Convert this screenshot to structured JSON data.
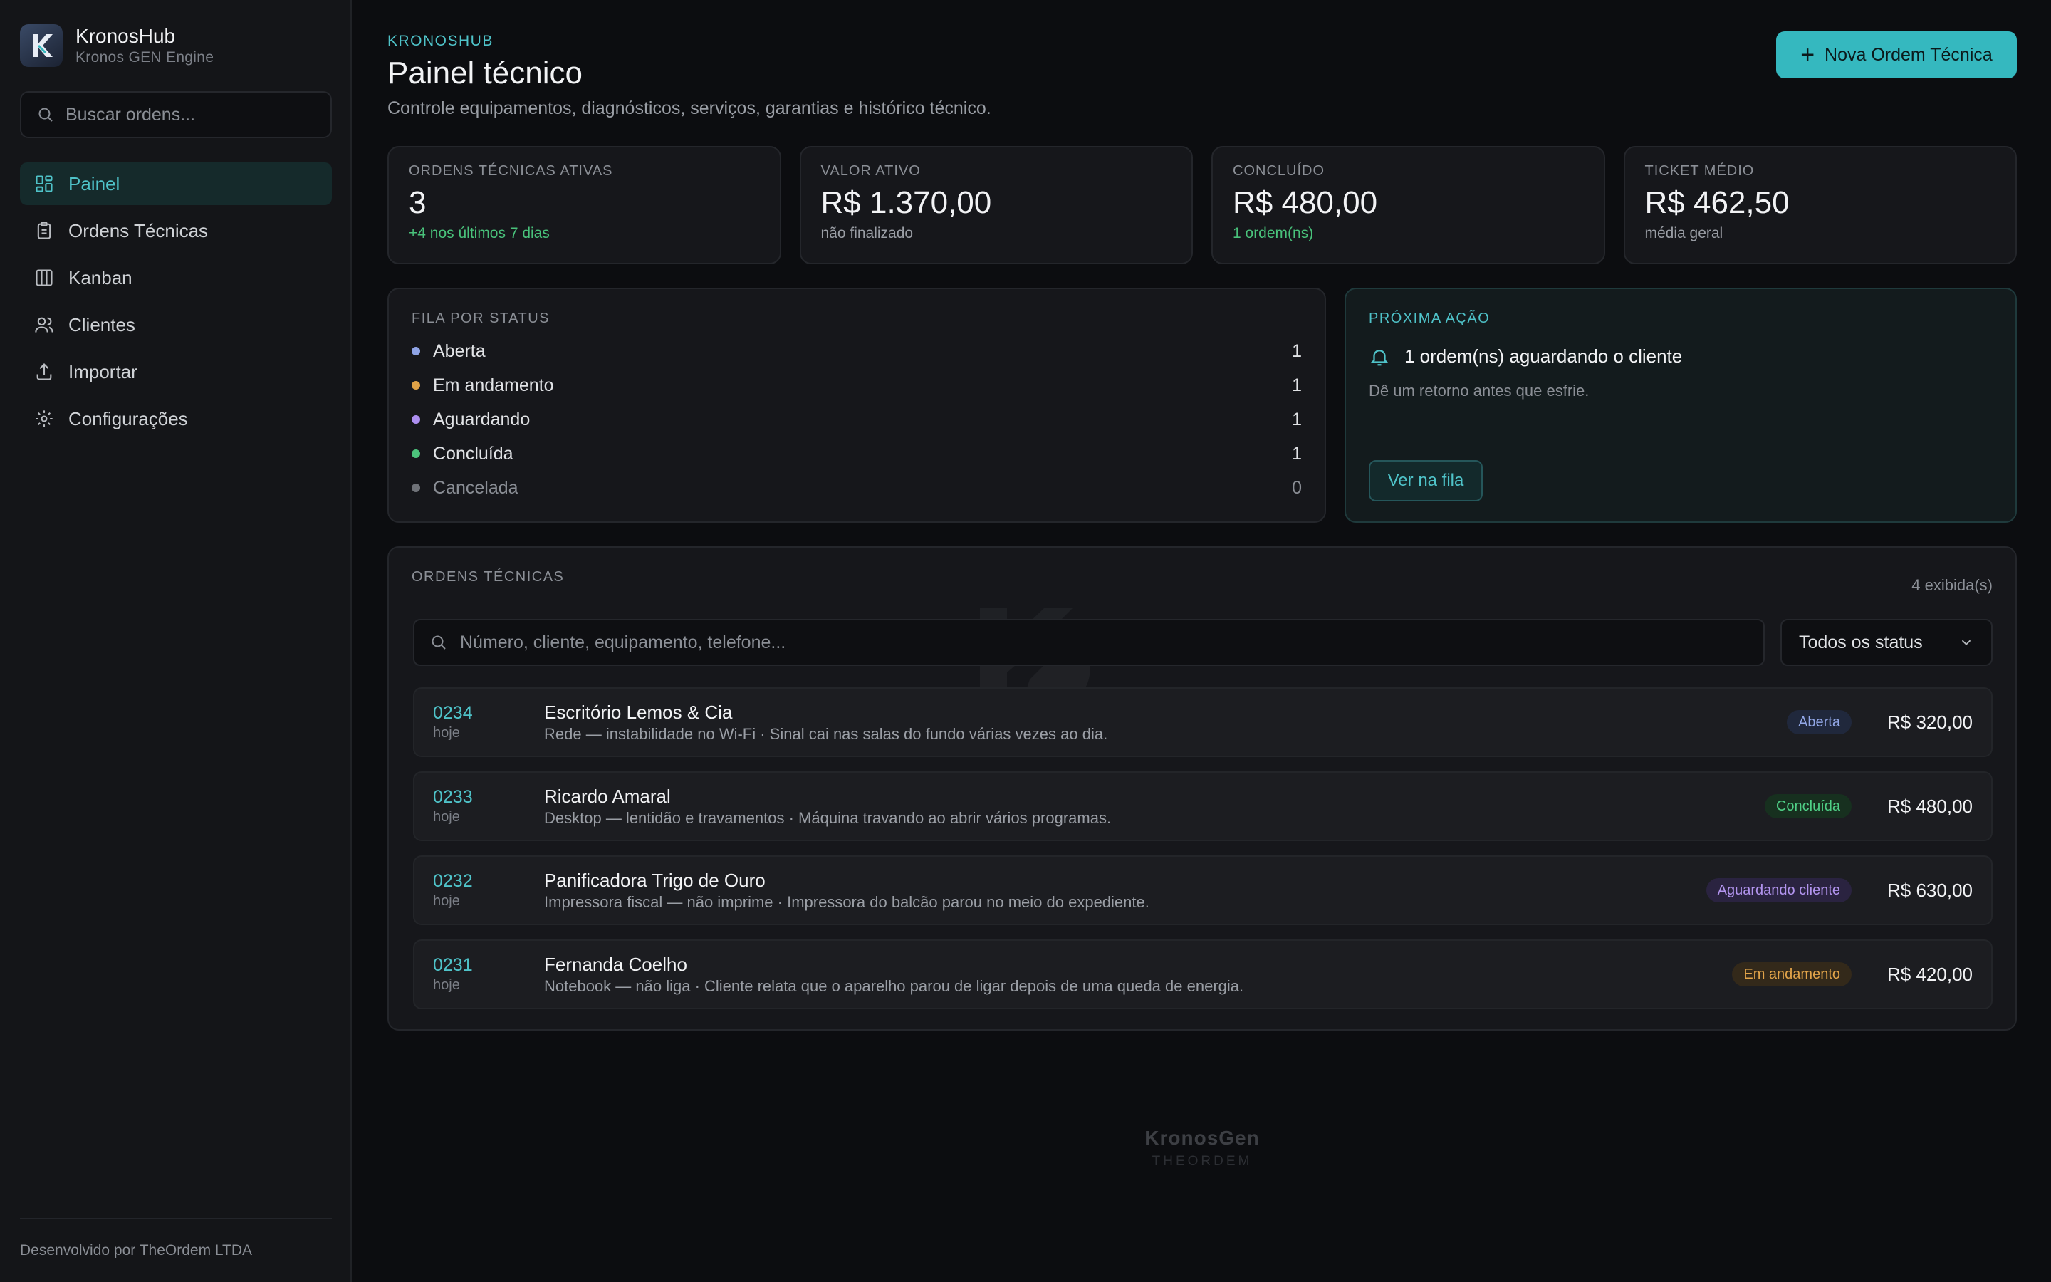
{
  "brand": {
    "name": "KronosHub",
    "subtitle": "Kronos GEN Engine",
    "logo_icon": "kronos-k-logo"
  },
  "sidebar": {
    "search_placeholder": "Buscar ordens...",
    "items": [
      {
        "label": "Painel",
        "icon": "dashboard-icon",
        "active": true
      },
      {
        "label": "Ordens Técnicas",
        "icon": "clipboard-icon"
      },
      {
        "label": "Kanban",
        "icon": "columns-icon"
      },
      {
        "label": "Clientes",
        "icon": "users-icon"
      },
      {
        "label": "Importar",
        "icon": "upload-icon"
      },
      {
        "label": "Configurações",
        "icon": "gear-icon"
      }
    ],
    "footer": "Desenvolvido por TheOrdem LTDA"
  },
  "header": {
    "eyebrow": "KRONOSHUB",
    "title": "Painel técnico",
    "description": "Controle equipamentos, diagnósticos, serviços, garantias e histórico técnico.",
    "new_button": "Nova Ordem Técnica"
  },
  "stats": [
    {
      "label": "ORDENS TÉCNICAS ATIVAS",
      "value": "3",
      "note": "+4 nos últimos 7 dias",
      "note_color": "#49c27b"
    },
    {
      "label": "VALOR ATIVO",
      "value": "R$ 1.370,00",
      "note": "não finalizado"
    },
    {
      "label": "CONCLUÍDO",
      "value": "R$ 480,00",
      "note": "1 ordem(ns)",
      "note_color": "#49c27b"
    },
    {
      "label": "TICKET MÉDIO",
      "value": "R$ 462,50",
      "note": "média geral"
    }
  ],
  "queue": {
    "label": "FILA POR STATUS",
    "rows": [
      {
        "name": "Aberta",
        "count": "1",
        "color": "#8fa4e6"
      },
      {
        "name": "Em andamento",
        "count": "1",
        "color": "#e0a247"
      },
      {
        "name": "Aguardando",
        "count": "1",
        "color": "#ad8ff0"
      },
      {
        "name": "Concluída",
        "count": "1",
        "color": "#4cc47c"
      },
      {
        "name": "Cancelada",
        "count": "0",
        "color": "#6f7278"
      }
    ]
  },
  "next_action": {
    "label": "PRÓXIMA AÇÃO",
    "title": "1 ordem(ns) aguardando o cliente",
    "description": "Dê um retorno antes que esfrie.",
    "button": "Ver na fila",
    "icon": "bell-icon"
  },
  "orders": {
    "label": "ORDENS TÉCNICAS",
    "count_text": "4 exibida(s)",
    "search_placeholder": "Número, cliente, equipamento, telefone...",
    "status_filter": "Todos os status",
    "rows": [
      {
        "id": "0234",
        "when": "hoje",
        "client": "Escritório Lemos & Cia",
        "desc": "Rede — instabilidade no Wi-Fi · Sinal cai nas salas do fundo várias vezes ao dia.",
        "status": "Aberta",
        "price": "R$ 320,00"
      },
      {
        "id": "0233",
        "when": "hoje",
        "client": "Ricardo Amaral",
        "desc": "Desktop — lentidão e travamentos · Máquina travando ao abrir vários programas.",
        "status": "Concluída",
        "price": "R$ 480,00"
      },
      {
        "id": "0232",
        "when": "hoje",
        "client": "Panificadora Trigo de Ouro",
        "desc": "Impressora fiscal — não imprime · Impressora do balcão parou no meio do expediente.",
        "status": "Aguardando cliente",
        "price": "R$ 630,00"
      },
      {
        "id": "0231",
        "when": "hoje",
        "client": "Fernanda Coelho",
        "desc": "Notebook — não liga · Cliente relata que o aparelho parou de ligar depois de uma queda de energia.",
        "status": "Em andamento",
        "price": "R$ 420,00"
      }
    ]
  },
  "footer_mark": {
    "name": "KronosGen",
    "sub": "THEORDEM"
  },
  "colors": {
    "accent": "#35b8bf",
    "background": "#0c0d10",
    "surface": "#16171b"
  }
}
